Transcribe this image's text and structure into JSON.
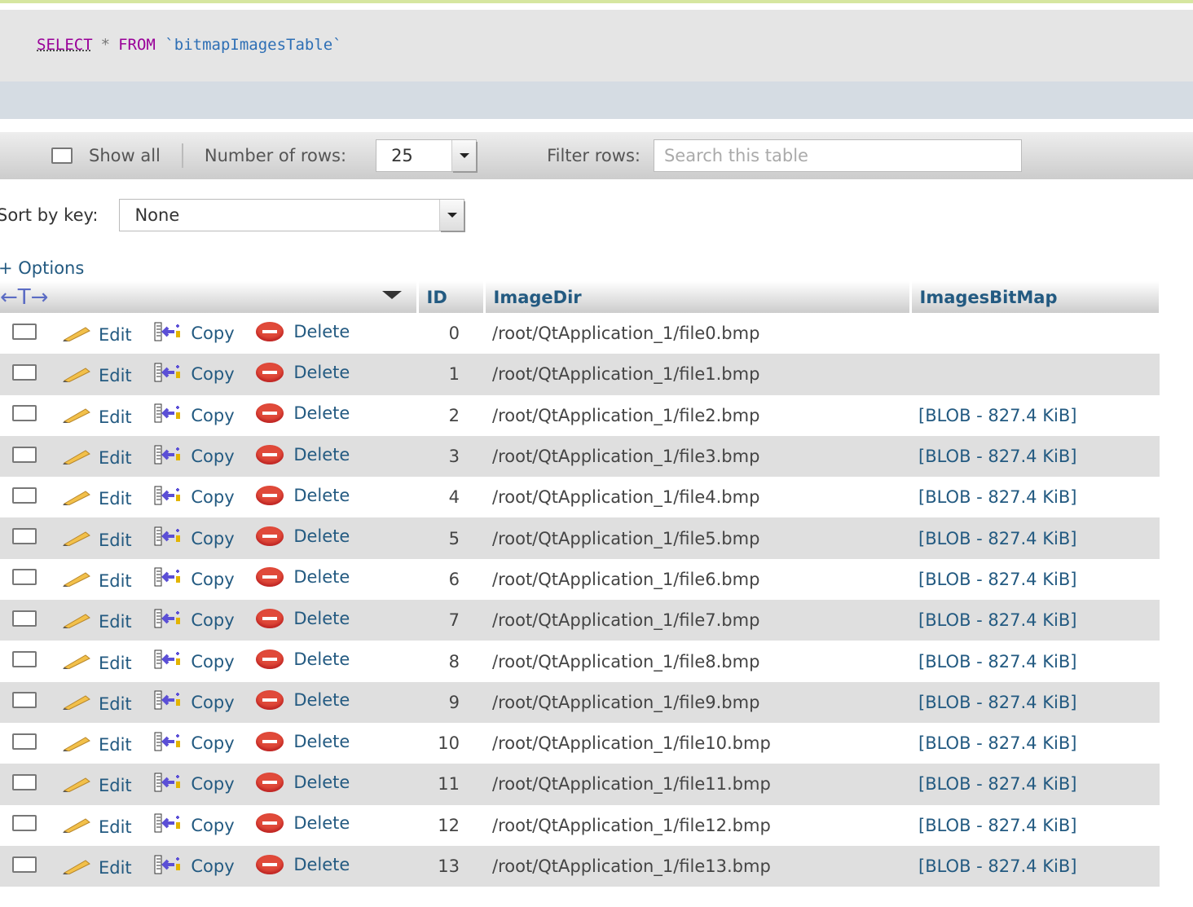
{
  "sql": {
    "select": "SELECT",
    "star": "*",
    "from": "FROM",
    "table": "`bitmapImagesTable`"
  },
  "nav": {
    "show_all": "Show all",
    "rows_label": "Number of rows:",
    "rows_value": "25",
    "filter_label": "Filter rows:",
    "filter_placeholder": "Search this table"
  },
  "sort": {
    "label": "Sort by key:",
    "value": "None"
  },
  "options": "+ Options",
  "columns": {
    "id": "ID",
    "imagedir": "ImageDir",
    "bitmap": "ImagesBitMap"
  },
  "actions": {
    "edit": "Edit",
    "copy": "Copy",
    "delete": "Delete"
  },
  "rows": [
    {
      "id": "0",
      "dir": "/root/QtApplication_1/file0.bmp",
      "blob": ""
    },
    {
      "id": "1",
      "dir": "/root/QtApplication_1/file1.bmp",
      "blob": ""
    },
    {
      "id": "2",
      "dir": "/root/QtApplication_1/file2.bmp",
      "blob": "[BLOB - 827.4 KiB]"
    },
    {
      "id": "3",
      "dir": "/root/QtApplication_1/file3.bmp",
      "blob": "[BLOB - 827.4 KiB]"
    },
    {
      "id": "4",
      "dir": "/root/QtApplication_1/file4.bmp",
      "blob": "[BLOB - 827.4 KiB]"
    },
    {
      "id": "5",
      "dir": "/root/QtApplication_1/file5.bmp",
      "blob": "[BLOB - 827.4 KiB]"
    },
    {
      "id": "6",
      "dir": "/root/QtApplication_1/file6.bmp",
      "blob": "[BLOB - 827.4 KiB]"
    },
    {
      "id": "7",
      "dir": "/root/QtApplication_1/file7.bmp",
      "blob": "[BLOB - 827.4 KiB]"
    },
    {
      "id": "8",
      "dir": "/root/QtApplication_1/file8.bmp",
      "blob": "[BLOB - 827.4 KiB]"
    },
    {
      "id": "9",
      "dir": "/root/QtApplication_1/file9.bmp",
      "blob": "[BLOB - 827.4 KiB]"
    },
    {
      "id": "10",
      "dir": "/root/QtApplication_1/file10.bmp",
      "blob": "[BLOB - 827.4 KiB]"
    },
    {
      "id": "11",
      "dir": "/root/QtApplication_1/file11.bmp",
      "blob": "[BLOB - 827.4 KiB]"
    },
    {
      "id": "12",
      "dir": "/root/QtApplication_1/file12.bmp",
      "blob": "[BLOB - 827.4 KiB]"
    },
    {
      "id": "13",
      "dir": "/root/QtApplication_1/file13.bmp",
      "blob": "[BLOB - 827.4 KiB]"
    }
  ]
}
